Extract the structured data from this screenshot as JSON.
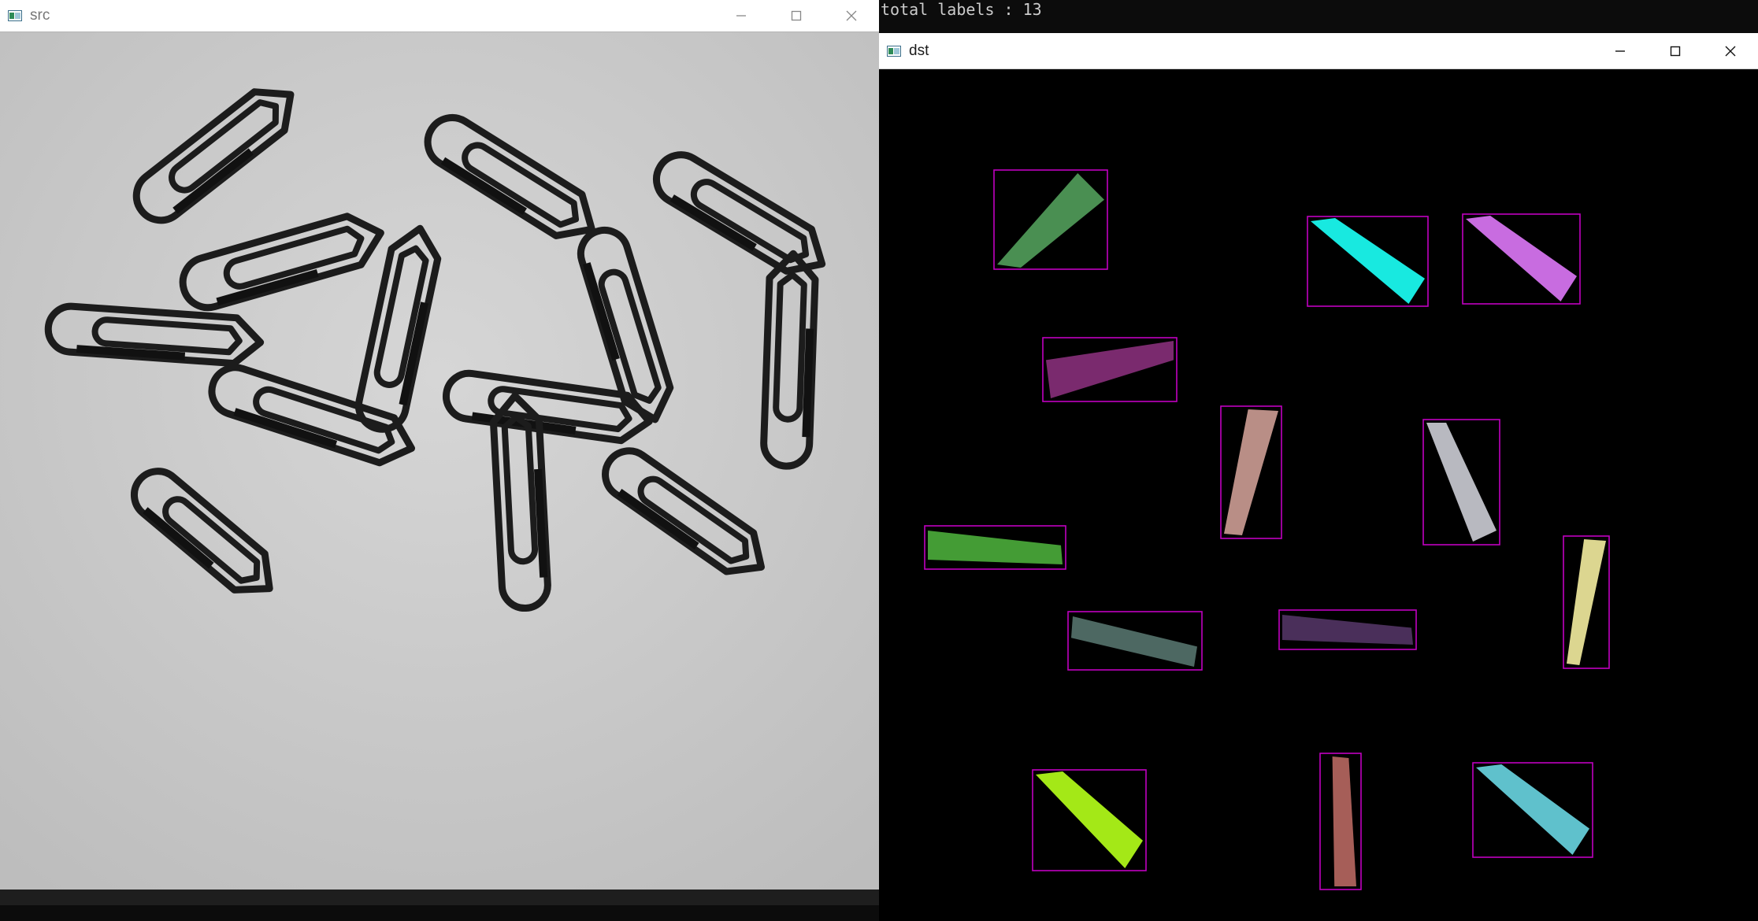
{
  "console": {
    "text": "total labels : 13"
  },
  "src_window": {
    "title": "src",
    "icons": {
      "app": "opencv-window-icon",
      "minimize": "minimize-icon",
      "maximize": "maximize-icon",
      "close": "close-icon"
    }
  },
  "dst_window": {
    "title": "dst",
    "icons": {
      "app": "opencv-window-icon",
      "minimize": "minimize-icon",
      "maximize": "maximize-icon",
      "close": "close-icon"
    }
  },
  "colors": {
    "bbox": "#c000c0",
    "labels": [
      "#4a8f52",
      "#18e9e0",
      "#c86ce0",
      "#7a2a6e",
      "#b98e86",
      "#b8b9c0",
      "#449c35",
      "#dcd690",
      "#4a2f5a",
      "#4d6862",
      "#a4e817",
      "#a65e58",
      "#5fc1cc"
    ]
  }
}
